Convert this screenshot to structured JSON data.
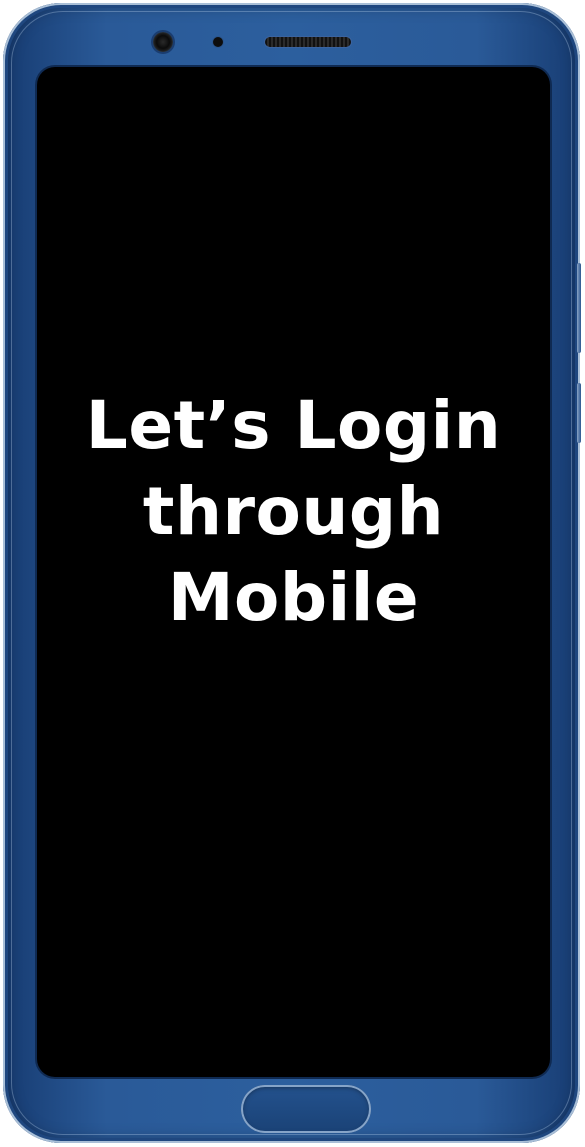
{
  "device": {
    "frame_color": "#2c5f9e",
    "screen_color": "#000000"
  },
  "screen": {
    "headline": "Let’s Login through Mobile",
    "text_color": "#ffffff"
  },
  "icons": {
    "camera": "front-camera-icon",
    "sensor": "proximity-sensor-icon",
    "speaker": "earpiece-speaker-icon"
  }
}
